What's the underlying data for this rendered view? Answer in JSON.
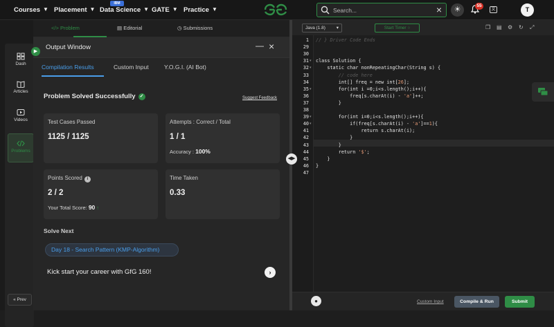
{
  "topnav": {
    "items": [
      "Courses",
      "Placement",
      "Data Science",
      "GATE",
      "Practice"
    ],
    "ibm_badge": "IBM",
    "search_placeholder": "Search...",
    "notification_count": "55",
    "avatar_initial": "T"
  },
  "sidebar": {
    "items": [
      "Dash",
      "Articles",
      "Videos",
      "Problems"
    ],
    "prev_label": "Prev"
  },
  "problem_tabs": [
    "Problem",
    "Editorial",
    "Submissions"
  ],
  "output": {
    "title": "Output Window",
    "tabs": [
      "Compilation Results",
      "Custom Input",
      "Y.O.G.I. (AI Bot)"
    ],
    "status": "Problem Solved Successfully",
    "suggest_feedback": "Suggest Feedback",
    "cards": {
      "test_cases_label": "Test Cases Passed",
      "test_cases_value": "1125 / 1125",
      "attempts_label": "Attempts : Correct / Total",
      "attempts_value": "1 / 1",
      "accuracy_label": "Accuracy :",
      "accuracy_value": "100%",
      "points_label": "Points Scored",
      "points_value": "2 / 2",
      "total_score_label": "Your Total Score:",
      "total_score_value": "90",
      "time_label": "Time Taken",
      "time_value": "0.33"
    },
    "solve_next_label": "Solve Next",
    "next_problem": "Day 18 - Search Pattern (KMP-Algorithm)",
    "kickstart": "Kick start your career with GfG 160!"
  },
  "editor": {
    "language": "Java (1.8)",
    "timer_label": "Start Timer",
    "line_numbers": [
      "1",
      "29",
      "30",
      "31",
      "32",
      "33",
      "34",
      "35",
      "36",
      "37",
      "38",
      "39",
      "40",
      "41",
      "42",
      "43",
      "44",
      "45",
      "46",
      "47"
    ],
    "code_lines": [
      "// } Driver Code Ends",
      "",
      "",
      "class Solution {",
      "    static char nonRepeatingChar(String s) {",
      "        // code here",
      "        int[] freq = new int[26];",
      "        for(int i =0;i<s.length();i++){",
      "            freq[s.charAt(i) - 'a']++;",
      "        }",
      "",
      "        for(int i=0;i<s.length();i++){",
      "            if(freq[s.charAt(i) - 'a']==1){",
      "                return s.charAt(i);",
      "            }",
      "        }",
      "        return '$';",
      "    }",
      "}",
      ""
    ],
    "custom_input_label": "Custom Input",
    "compile_label": "Compile & Run",
    "submit_label": "Submit"
  },
  "colors": {
    "brand_green": "#2f8d46",
    "link_blue": "#4a9eea",
    "badge_red": "#d93025"
  }
}
